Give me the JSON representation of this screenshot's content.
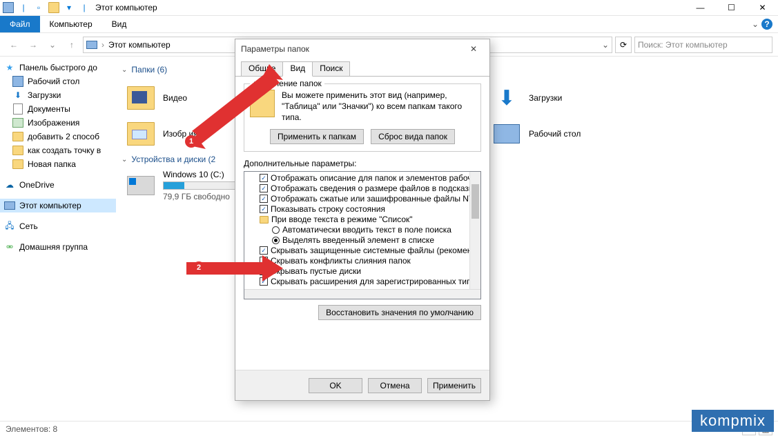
{
  "titlebar": {
    "title": "Этот компьютер"
  },
  "ribbon": {
    "tabs": [
      "Файл",
      "Компьютер",
      "Вид"
    ]
  },
  "address": {
    "crumb_label": "Этот компьютер",
    "search_placeholder": "Поиск: Этот компьютер"
  },
  "sidebar": {
    "quick_access": "Панель быстрого до",
    "items_qa": [
      "Рабочий стол",
      "Загрузки",
      "Документы",
      "Изображения",
      "добавить 2 способ",
      "как создать точку в",
      "Новая папка"
    ],
    "onedrive": "OneDrive",
    "this_pc": "Этот компьютер",
    "network": "Сеть",
    "homegroup": "Домашняя группа"
  },
  "content": {
    "group_folders": "Папки (6)",
    "folders": [
      "Видео",
      "Изобр       ия",
      "Загрузки",
      "Рабочий стол"
    ],
    "group_drives": "Устройства и диски (2",
    "drive": {
      "name": "Windows 10 (C:)",
      "free": "79,9 ГБ свободно ",
      "fill_pct": 25
    }
  },
  "status": {
    "count": "Элементов: 8"
  },
  "dialog": {
    "title": "Параметры папок",
    "tabs": [
      "Общие",
      "Вид",
      "Поиск"
    ],
    "group1_title": "дставление папок",
    "group1_text": "Вы можете применить этот вид (например, \"Таблица\" или \"Значки\") ко всем папкам такого типа.",
    "btn_apply_folders": "Применить к папкам",
    "btn_reset_folders": "Сброс вида папок",
    "adv_label": "Дополнительные параметры:",
    "options": [
      {
        "kind": "cb",
        "checked": true,
        "indent": 1,
        "text": "Отображать описание для папок и элементов рабоче"
      },
      {
        "kind": "cb",
        "checked": true,
        "indent": 1,
        "text": "Отображать сведения о размере файлов в подсказк"
      },
      {
        "kind": "cb",
        "checked": true,
        "indent": 1,
        "text": "Отображать сжатые или зашифрованные файлы NTF"
      },
      {
        "kind": "cb",
        "checked": true,
        "indent": 1,
        "text": "Показывать строку состояния"
      },
      {
        "kind": "hdr",
        "checked": false,
        "indent": 1,
        "text": "При вводе текста в режиме \"Список\""
      },
      {
        "kind": "rb",
        "checked": false,
        "indent": 2,
        "text": "Автоматически вводить текст в поле поиска"
      },
      {
        "kind": "rb",
        "checked": true,
        "indent": 2,
        "text": "Выделять введенный элемент в списке"
      },
      {
        "kind": "cb",
        "checked": true,
        "indent": 1,
        "text": "Скрывать защищенные системные файлы (рекомен"
      },
      {
        "kind": "cb",
        "checked": true,
        "indent": 1,
        "text": "Скрывать конфликты слияния папок"
      },
      {
        "kind": "cb",
        "checked": true,
        "indent": 1,
        "text": "Скрывать пустые диски"
      },
      {
        "kind": "cb",
        "checked": true,
        "indent": 1,
        "text": "Скрывать расширения для зарегистрированных типо"
      }
    ],
    "btn_restore": "Восстановить значения по умолчанию",
    "btn_ok": "OK",
    "btn_cancel": "Отмена",
    "btn_apply": "Применить"
  },
  "badges": [
    "1",
    "2"
  ],
  "watermark": "kompmix"
}
